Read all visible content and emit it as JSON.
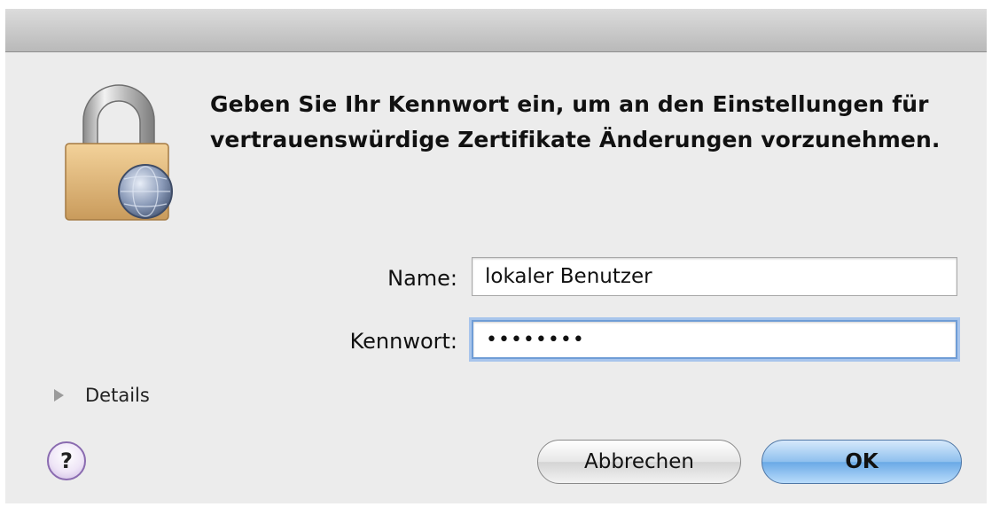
{
  "dialog": {
    "message": "Geben Sie Ihr Kennwort ein, um an den Einstellungen für vertrauenswürdige Zertifikate Änderungen vorzunehmen."
  },
  "form": {
    "name_label": "Name:",
    "name_value": "lokaler Benutzer",
    "password_label": "Kennwort:",
    "password_value": "••••••••"
  },
  "details": {
    "label": "Details"
  },
  "buttons": {
    "help": "?",
    "cancel": "Abbrechen",
    "ok": "OK"
  },
  "icons": {
    "lock": "lock-with-globe-icon",
    "disclosure": "disclosure-triangle-icon"
  }
}
